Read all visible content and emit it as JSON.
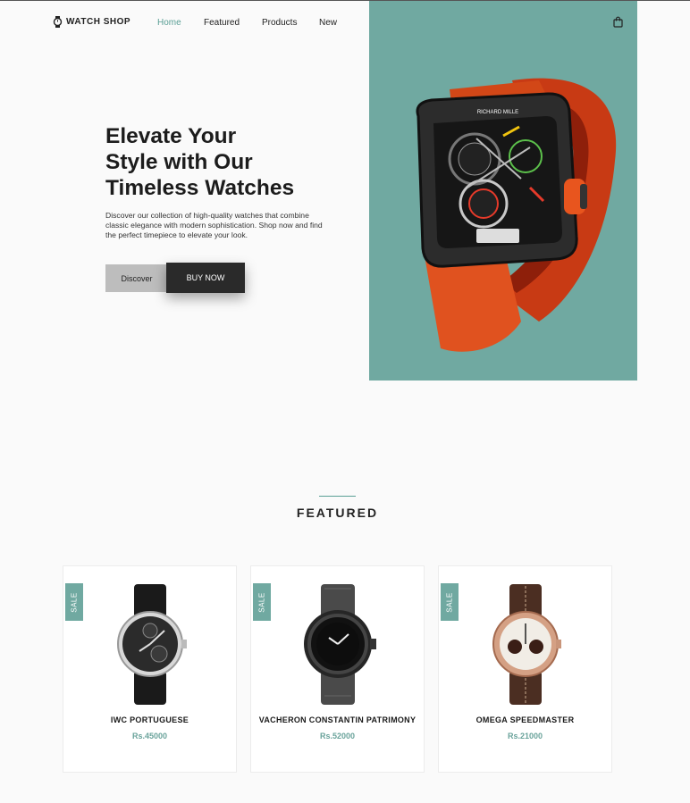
{
  "header": {
    "logo_text": "WATCH SHOP",
    "logo_icon": "watch-icon",
    "nav": [
      {
        "label": "Home",
        "active": true
      },
      {
        "label": "Featured",
        "active": false
      },
      {
        "label": "Products",
        "active": false
      },
      {
        "label": "New",
        "active": false
      }
    ],
    "cart_icon": "shopping-bag-icon"
  },
  "hero": {
    "headline_lines": [
      "Elevate Your",
      "Style with Our",
      "Timeless Watches"
    ],
    "description": "Discover our collection of high-quality watches that combine classic elegance with modern sophistication. Shop now and find the perfect timepiece to elevate your look.",
    "discover_label": "Discover",
    "buy_label": "BUY NOW",
    "background_color": "#70a9a1",
    "accent_strap_color": "#e0521f",
    "watch_dial_text": "RICHARD MILLE"
  },
  "featured": {
    "title": "FEATURED",
    "accent_color": "#5a9f95",
    "products": [
      {
        "badge": "SALE",
        "name": "IWC PORTUGUESE",
        "price": "Rs.45000"
      },
      {
        "badge": "SALE",
        "name": "VACHERON CONSTANTIN PATRIMONY",
        "price": "Rs.52000"
      },
      {
        "badge": "SALE",
        "name": "OMEGA SPEEDMASTER",
        "price": "Rs.21000"
      }
    ]
  }
}
